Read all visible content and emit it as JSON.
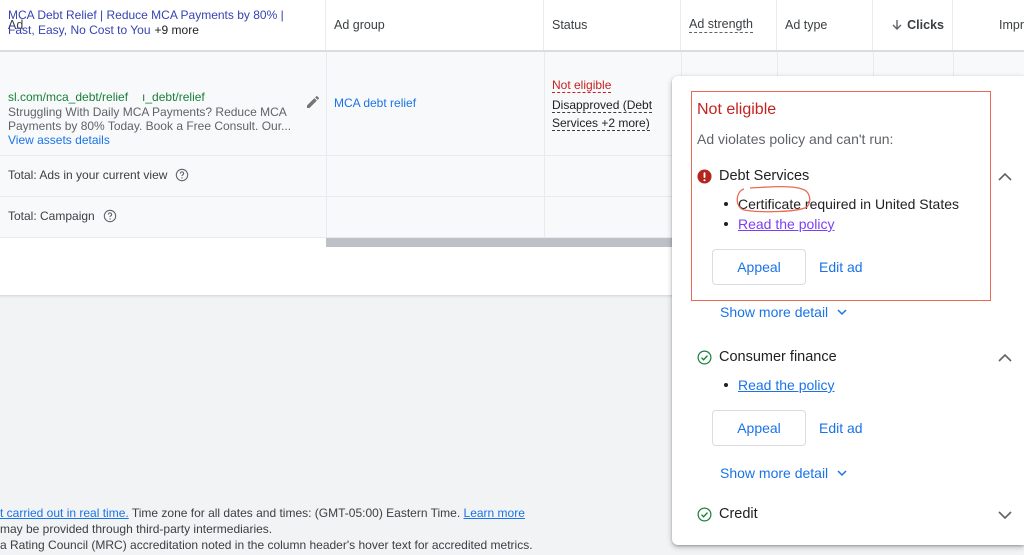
{
  "table": {
    "columns": [
      {
        "label": "Ad"
      },
      {
        "label": "Ad group"
      },
      {
        "label": "Status"
      },
      {
        "label": "Ad strength"
      },
      {
        "label": "Ad type"
      },
      {
        "label": "Clicks",
        "sort": "descending"
      },
      {
        "label": "Impr"
      }
    ],
    "ad_row": {
      "headline": "MCA Debt Relief | Reduce MCA Payments by 80% | Fast, Easy, No Cost to You",
      "headline_more": "+9 more",
      "display_url_1": "sl.com/mca_debt/relief",
      "display_url_2": "ı_debt/relief",
      "description": "Struggling With Daily MCA Payments? Reduce MCA Payments by 80% Today. Book a Free Consult. Our...",
      "view_assets": "View assets details",
      "ad_group": "MCA debt relief",
      "status": "Not eligible",
      "status_detail": "Disapproved (Debt Services +2 more)"
    },
    "totals": [
      {
        "label": "Total: Ads in your current view"
      },
      {
        "label": "Total: Campaign"
      }
    ]
  },
  "footer": {
    "line1_link": "t carried out in real time.",
    "line1_text": " Time zone for all dates and times: (GMT-05:00) Eastern Time. ",
    "line1_learn": "Learn more",
    "line2": " may be provided through third-party intermediaries.",
    "line3": "a Rating Council (MRC) accreditation noted in the column header's hover text for accredited metrics."
  },
  "popup": {
    "title": "Not eligible",
    "subtitle": "Ad violates policy and can't run:",
    "sections": [
      {
        "name": "Debt Services",
        "state": "error",
        "expanded": true,
        "bullets": [
          "Certificate required in United States"
        ],
        "link": "Read the policy",
        "appeal": "Appeal",
        "edit": "Edit ad",
        "show_more": "Show more detail"
      },
      {
        "name": "Consumer finance",
        "state": "ok",
        "expanded": true,
        "link": "Read the policy",
        "appeal": "Appeal",
        "edit": "Edit ad",
        "show_more": "Show more detail"
      },
      {
        "name": "Credit",
        "state": "ok",
        "expanded": false
      }
    ],
    "colors": {
      "error": "#c5221f",
      "ok": "#188038",
      "link": "#1a73e8",
      "visited_link": "#7e3ff2",
      "annotation": "#ea6b53"
    }
  }
}
